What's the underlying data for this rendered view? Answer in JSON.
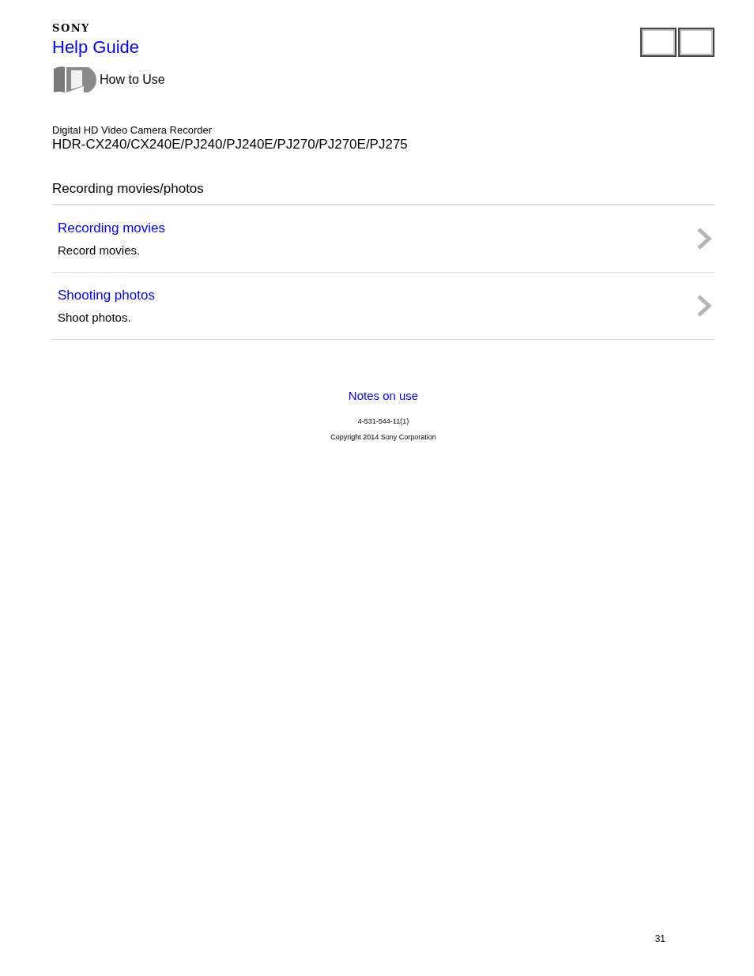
{
  "brand": "SONY",
  "title": "Help Guide",
  "section": "How to Use",
  "product": {
    "category": "Digital HD Video Camera Recorder",
    "models": "HDR-CX240/CX240E/PJ240/PJ240E/PJ270/PJ270E/PJ275"
  },
  "heading": "Recording movies/photos",
  "items": [
    {
      "link": "Recording movies",
      "description": "Record movies."
    },
    {
      "link": "Shooting photos",
      "description": "Shoot photos."
    }
  ],
  "footer": {
    "link": "Notes on use",
    "code": "4-531-544-11(1)",
    "copyright": "Copyright 2014 Sony Corporation"
  },
  "page_number": "31"
}
